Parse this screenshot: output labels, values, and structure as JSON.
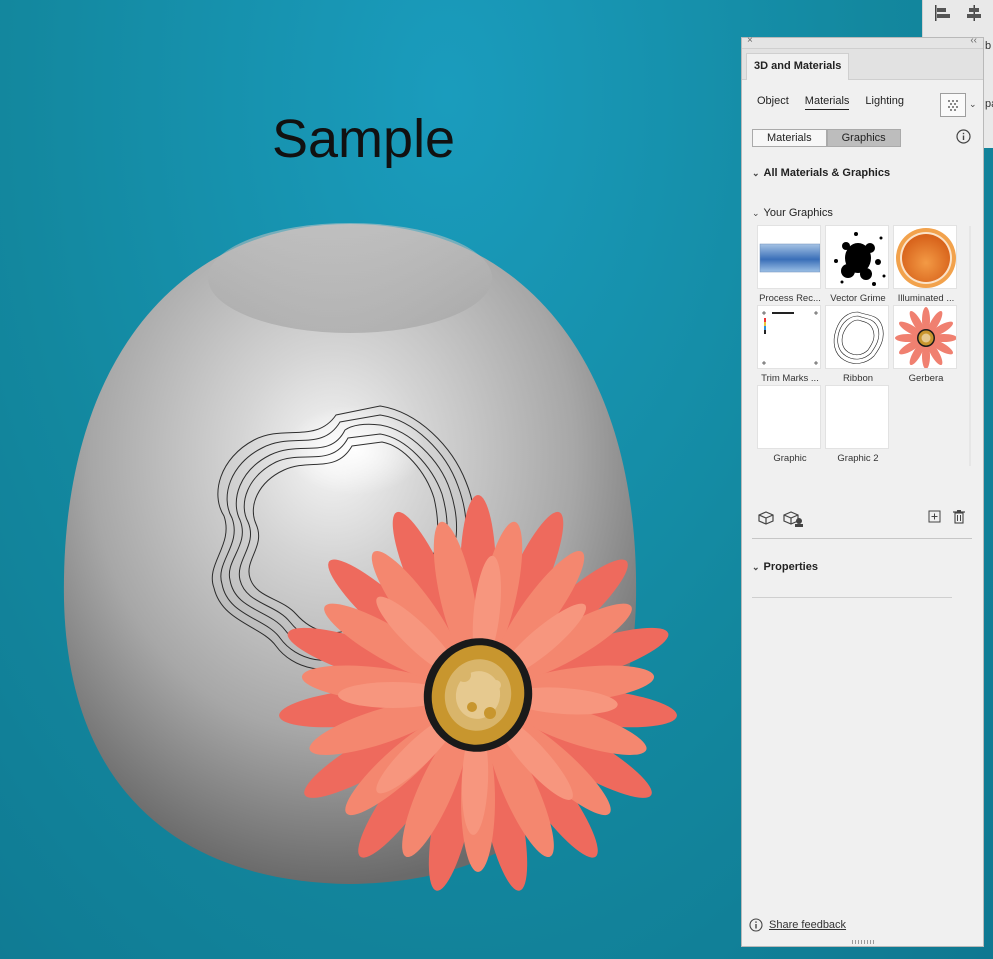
{
  "canvas": {
    "sample_text": "Sample"
  },
  "toolbar_top": {
    "partial_label_1": "b",
    "partial_label_2": "pa"
  },
  "panel": {
    "title": "3D and Materials",
    "close_glyph": "×",
    "collapse_glyph": "‹‹",
    "subtabs": [
      {
        "label": "Object",
        "active": false
      },
      {
        "label": "Materials",
        "active": true
      },
      {
        "label": "Lighting",
        "active": false
      }
    ],
    "segment": {
      "options": [
        "Materials",
        "Graphics"
      ],
      "selected": "Graphics"
    },
    "sections": {
      "all": "All Materials & Graphics",
      "yours": "Your Graphics",
      "properties": "Properties"
    },
    "graphics": [
      {
        "name": "Process Rec...",
        "icon": "process-rectangle-thumbnail"
      },
      {
        "name": "Vector Grime",
        "icon": "vector-grime-thumbnail"
      },
      {
        "name": "Illuminated ...",
        "icon": "illuminated-button-thumbnail"
      },
      {
        "name": "Trim Marks ...",
        "icon": "trim-marks-thumbnail"
      },
      {
        "name": "Ribbon",
        "icon": "ribbon-thumbnail"
      },
      {
        "name": "Gerbera",
        "icon": "gerbera-thumbnail"
      },
      {
        "name": "Graphic",
        "icon": "blank-thumbnail"
      },
      {
        "name": "Graphic 2",
        "icon": "blank-thumbnail"
      }
    ],
    "feedback": "Share feedback"
  },
  "colors": {
    "background": "#1390ab",
    "petal": "#f4806e",
    "petal_dark": "#ee6a5d",
    "flower_center": "#c8962e",
    "panel_bg": "#f0f0f0"
  }
}
